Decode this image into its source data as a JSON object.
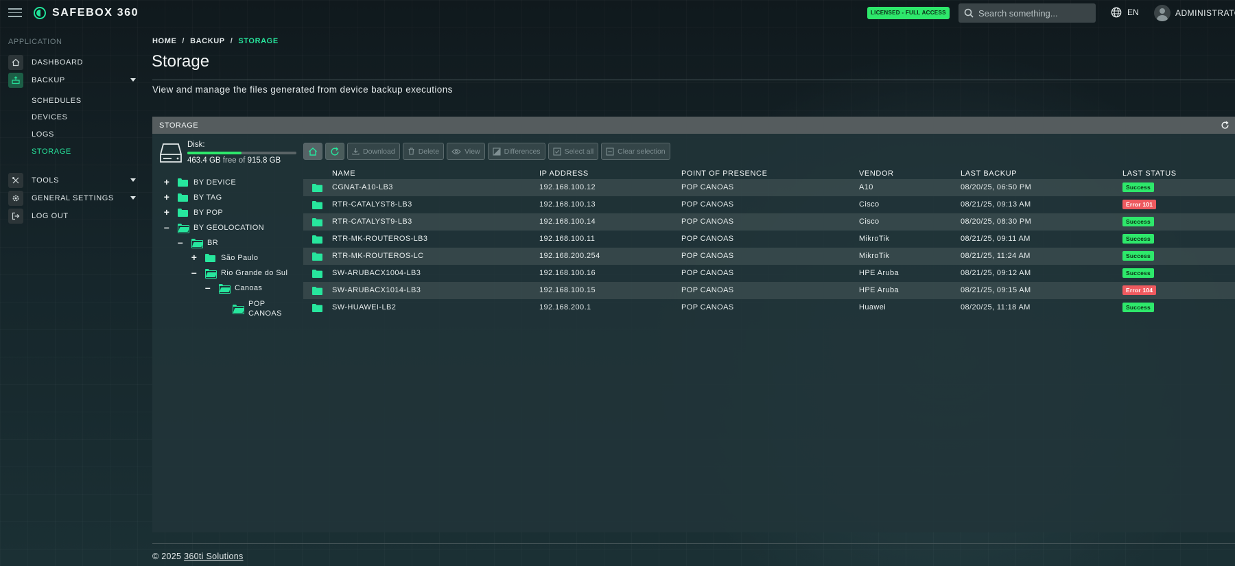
{
  "app": {
    "brand": "SAFEBOX 360",
    "license_badge": "LICENSED - FULL ACCESS",
    "search_placeholder": "Search something...",
    "language": "EN",
    "user": "ADMINISTRATOR"
  },
  "sidebar": {
    "section": "APPLICATION",
    "items": [
      {
        "label": "DASHBOARD"
      },
      {
        "label": "BACKUP"
      },
      {
        "label": "TOOLS"
      },
      {
        "label": "GENERAL SETTINGS"
      },
      {
        "label": "LOG OUT"
      }
    ],
    "backup_children": [
      {
        "label": "SCHEDULES"
      },
      {
        "label": "DEVICES"
      },
      {
        "label": "LOGS"
      },
      {
        "label": "STORAGE"
      }
    ]
  },
  "breadcrumb": [
    "HOME",
    "BACKUP",
    "STORAGE"
  ],
  "page": {
    "title": "Storage",
    "description": "View and manage the files generated from device backup executions"
  },
  "panel": {
    "title": "STORAGE",
    "disk": {
      "label": "Disk:",
      "free": "463.4 GB",
      "free_word": "free of",
      "total": "915.8 GB",
      "used_fraction": 0.494
    },
    "toolbar": {
      "download": "Download",
      "delete": "Delete",
      "view": "View",
      "differences": "Differences",
      "select_all": "Select all",
      "clear_selection": "Clear selection"
    },
    "tree": {
      "by_device": "BY DEVICE",
      "by_tag": "BY TAG",
      "by_pop": "BY POP",
      "by_geolocation": "BY GEOLOCATION",
      "br": "BR",
      "sao_paulo": "São Paulo",
      "rio_grande": "Rio Grande do Sul",
      "canoas": "Canoas",
      "pop_canoas_1": "POP",
      "pop_canoas_2": "CANOAS"
    },
    "columns": {
      "name": "NAME",
      "ip": "IP ADDRESS",
      "pop": "POINT OF PRESENCE",
      "vendor": "VENDOR",
      "last_backup": "LAST BACKUP",
      "last_status": "LAST STATUS"
    },
    "rows": [
      {
        "name": "CGNAT-A10-LB3",
        "ip": "192.168.100.12",
        "pop": "POP CANOAS",
        "vendor": "A10",
        "last_backup": "08/20/25, 06:50 PM",
        "status": "Success",
        "status_type": "ok"
      },
      {
        "name": "RTR-CATALYST8-LB3",
        "ip": "192.168.100.13",
        "pop": "POP CANOAS",
        "vendor": "Cisco",
        "last_backup": "08/21/25, 09:13 AM",
        "status": "Error 101",
        "status_type": "err"
      },
      {
        "name": "RTR-CATALYST9-LB3",
        "ip": "192.168.100.14",
        "pop": "POP CANOAS",
        "vendor": "Cisco",
        "last_backup": "08/20/25, 08:30 PM",
        "status": "Success",
        "status_type": "ok"
      },
      {
        "name": "RTR-MK-ROUTEROS-LB3",
        "ip": "192.168.100.11",
        "pop": "POP CANOAS",
        "vendor": "MikroTik",
        "last_backup": "08/21/25, 09:11 AM",
        "status": "Success",
        "status_type": "ok"
      },
      {
        "name": "RTR-MK-ROUTEROS-LC",
        "ip": "192.168.200.254",
        "pop": "POP CANOAS",
        "vendor": "MikroTik",
        "last_backup": "08/21/25, 11:24 AM",
        "status": "Success",
        "status_type": "ok"
      },
      {
        "name": "SW-ARUBACX1004-LB3",
        "ip": "192.168.100.16",
        "pop": "POP CANOAS",
        "vendor": "HPE Aruba",
        "last_backup": "08/21/25, 09:12 AM",
        "status": "Success",
        "status_type": "ok"
      },
      {
        "name": "SW-ARUBACX1014-LB3",
        "ip": "192.168.100.15",
        "pop": "POP CANOAS",
        "vendor": "HPE Aruba",
        "last_backup": "08/21/25, 09:15 AM",
        "status": "Error 104",
        "status_type": "err"
      },
      {
        "name": "SW-HUAWEI-LB2",
        "ip": "192.168.200.1",
        "pop": "POP CANOAS",
        "vendor": "Huawei",
        "last_backup": "08/20/25, 11:18 AM",
        "status": "Success",
        "status_type": "ok"
      }
    ]
  },
  "footer": {
    "copyright": "© 2025",
    "company": "360ti Solutions"
  },
  "colors": {
    "accent": "#27e69d",
    "success": "#2ee86b",
    "error": "#ee5a5f"
  }
}
